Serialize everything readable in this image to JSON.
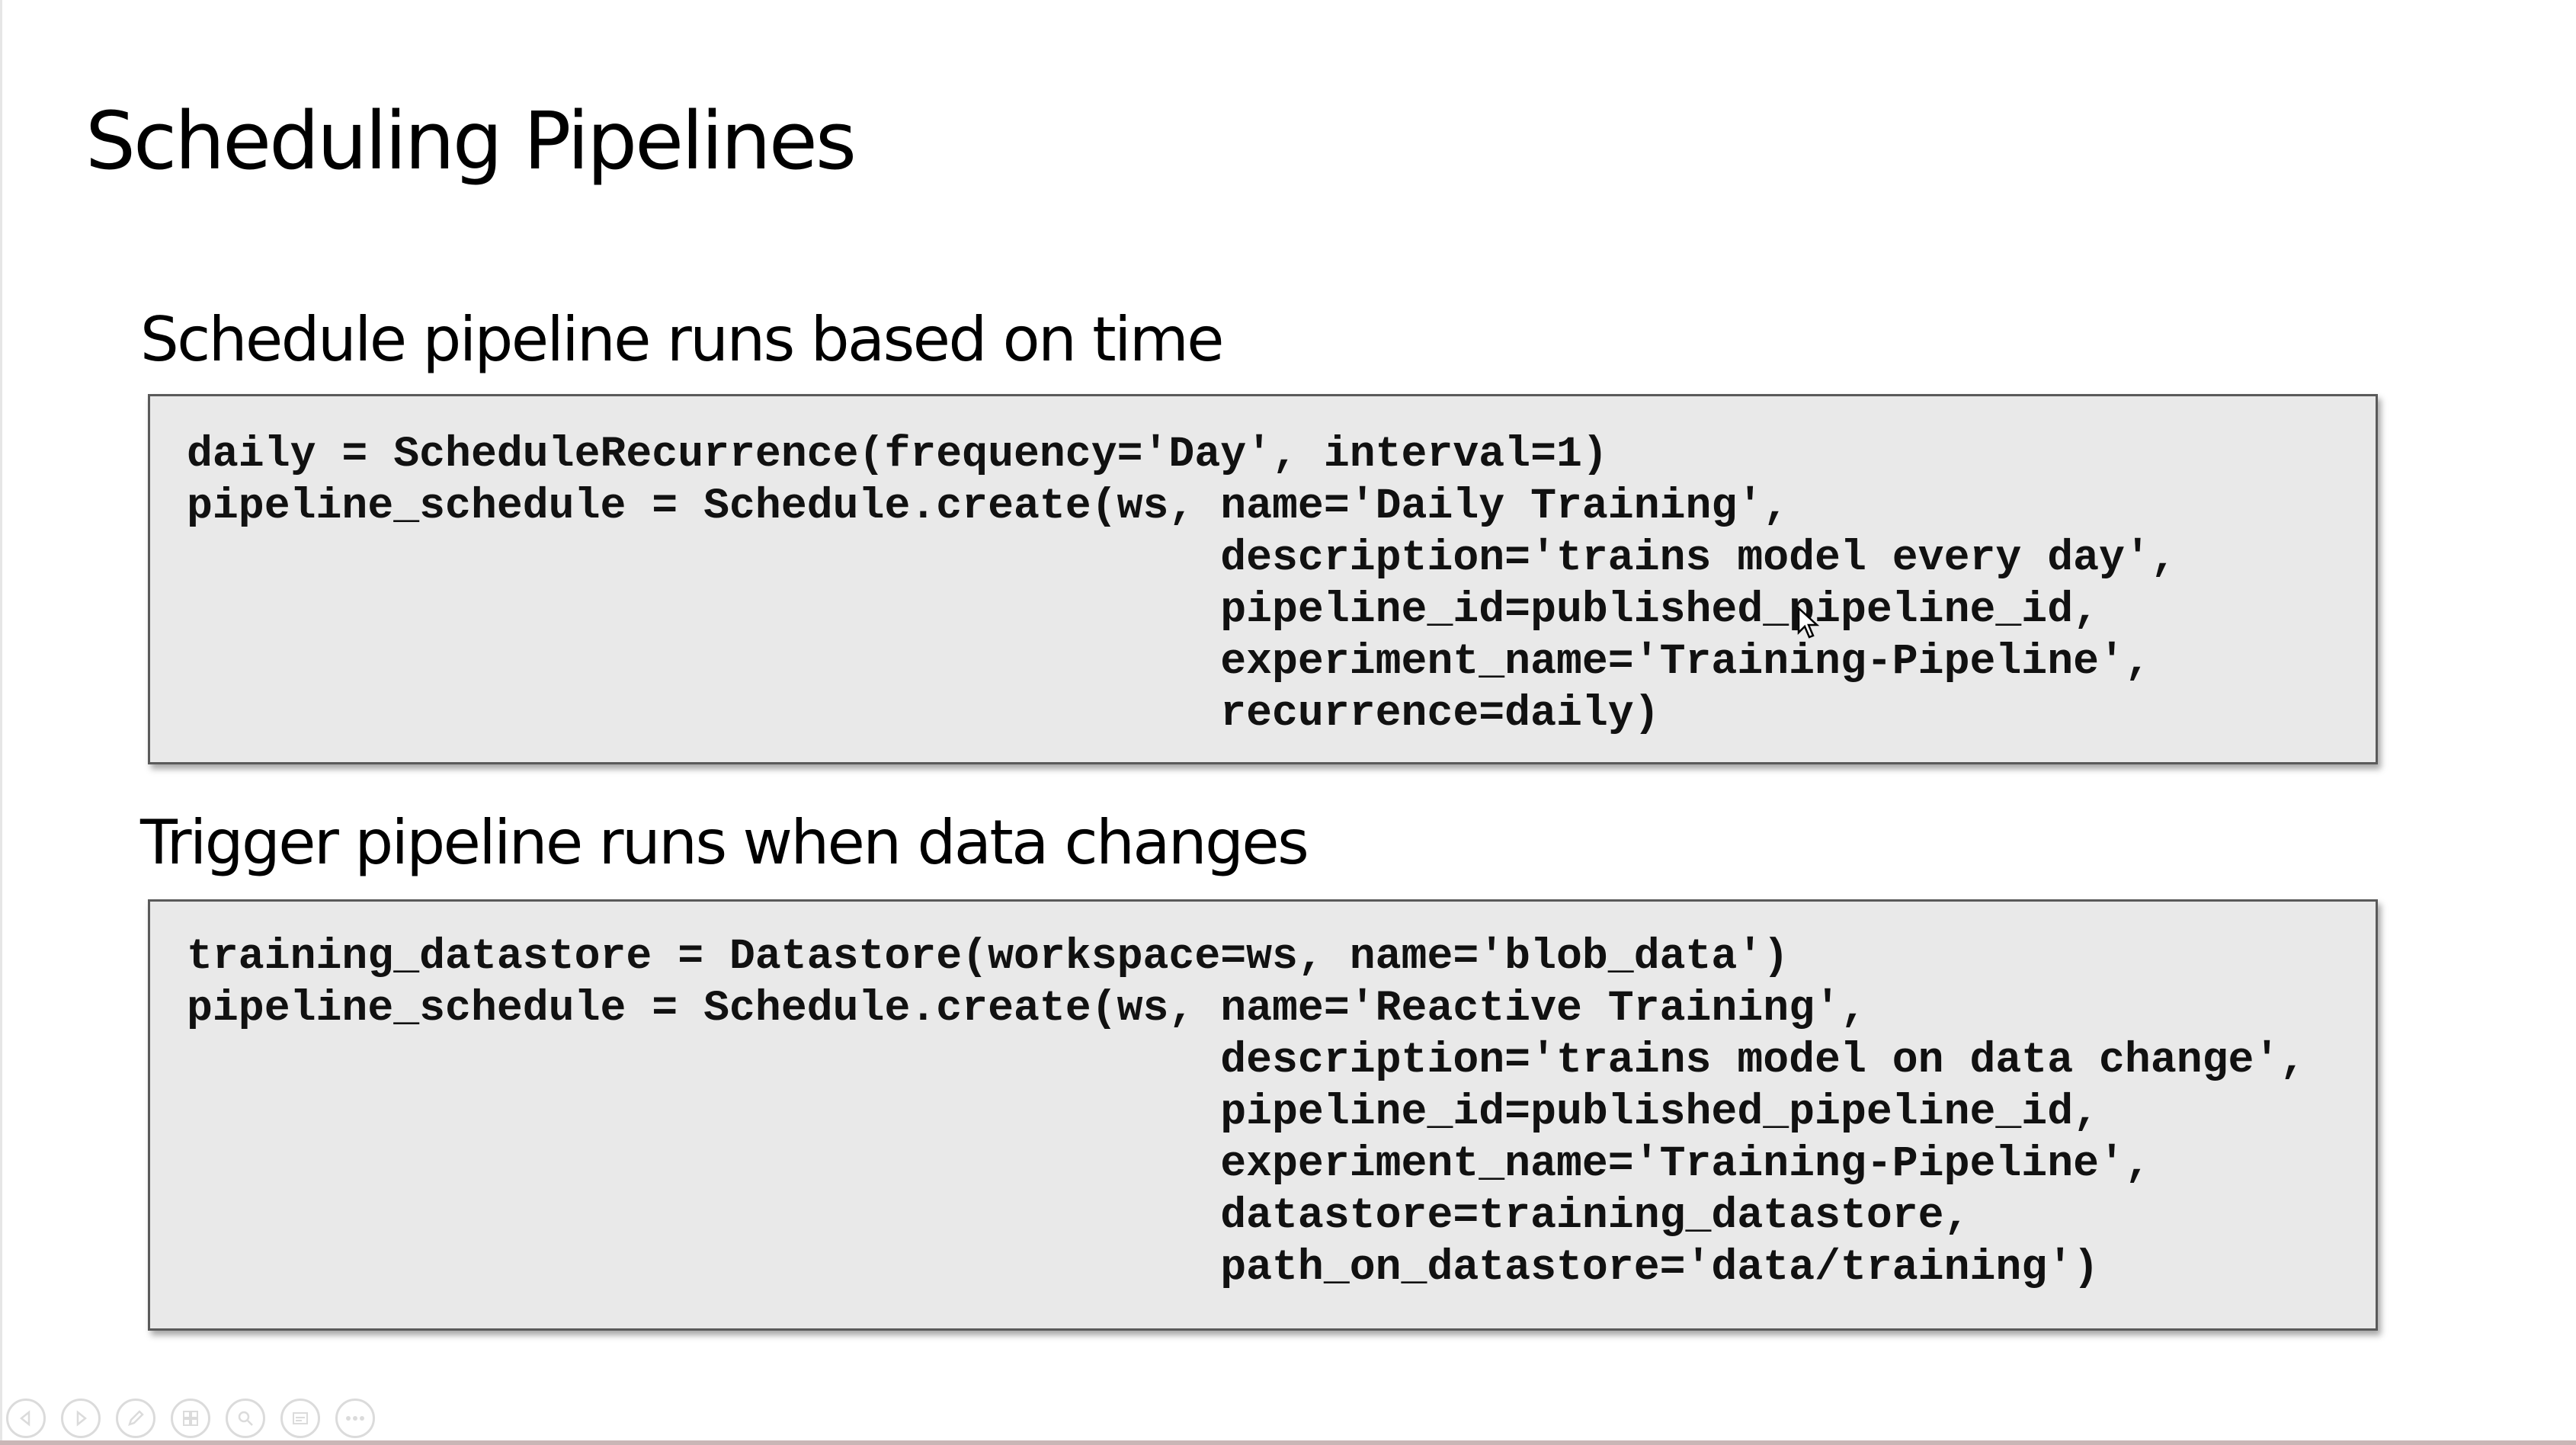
{
  "slide": {
    "title": "Scheduling Pipelines",
    "sections": [
      {
        "heading": "Schedule pipeline runs based on time",
        "code_lines": [
          "daily = ScheduleRecurrence(frequency='Day', interval=1)",
          "pipeline_schedule = Schedule.create(ws, name='Daily Training',",
          "                                        description='trains model every day',",
          "                                        pipeline_id=published_pipeline_id,",
          "                                        experiment_name='Training-Pipeline',",
          "                                        recurrence=daily)"
        ]
      },
      {
        "heading": "Trigger pipeline runs when data changes",
        "code_lines": [
          "training_datastore = Datastore(workspace=ws, name='blob_data')",
          "pipeline_schedule = Schedule.create(ws, name='Reactive Training',",
          "                                        description='trains model on data change',",
          "                                        pipeline_id=published_pipeline_id,",
          "                                        experiment_name='Training-Pipeline',",
          "                                        datastore=training_datastore,",
          "                                        path_on_datastore='data/training')"
        ]
      }
    ]
  },
  "toolbar": {
    "buttons": [
      {
        "icon": "previous-icon"
      },
      {
        "icon": "next-icon"
      },
      {
        "icon": "pen-icon"
      },
      {
        "icon": "slides-icon"
      },
      {
        "icon": "zoom-icon"
      },
      {
        "icon": "subtitles-icon"
      },
      {
        "icon": "more-icon"
      }
    ]
  }
}
